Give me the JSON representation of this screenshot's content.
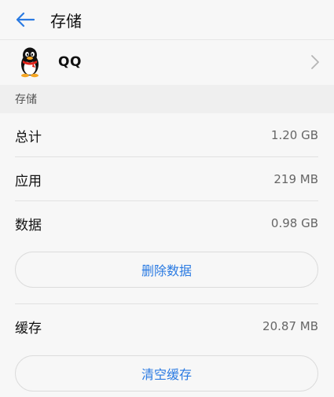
{
  "header": {
    "title": "存储",
    "back_icon": "back-arrow-icon"
  },
  "app": {
    "name": "QQ",
    "icon": "qq-penguin-icon"
  },
  "section": {
    "title": "存储"
  },
  "rows": {
    "total": {
      "label": "总计",
      "value": "1.20 GB"
    },
    "app": {
      "label": "应用",
      "value": "219 MB"
    },
    "data": {
      "label": "数据",
      "value": "0.98 GB"
    },
    "cache": {
      "label": "缓存",
      "value": "20.87 MB"
    }
  },
  "buttons": {
    "delete_data": "删除数据",
    "clear_cache": "清空缓存"
  },
  "colors": {
    "accent": "#2a7ae2",
    "background": "#f7f7f7",
    "section_bg": "#efefef"
  }
}
